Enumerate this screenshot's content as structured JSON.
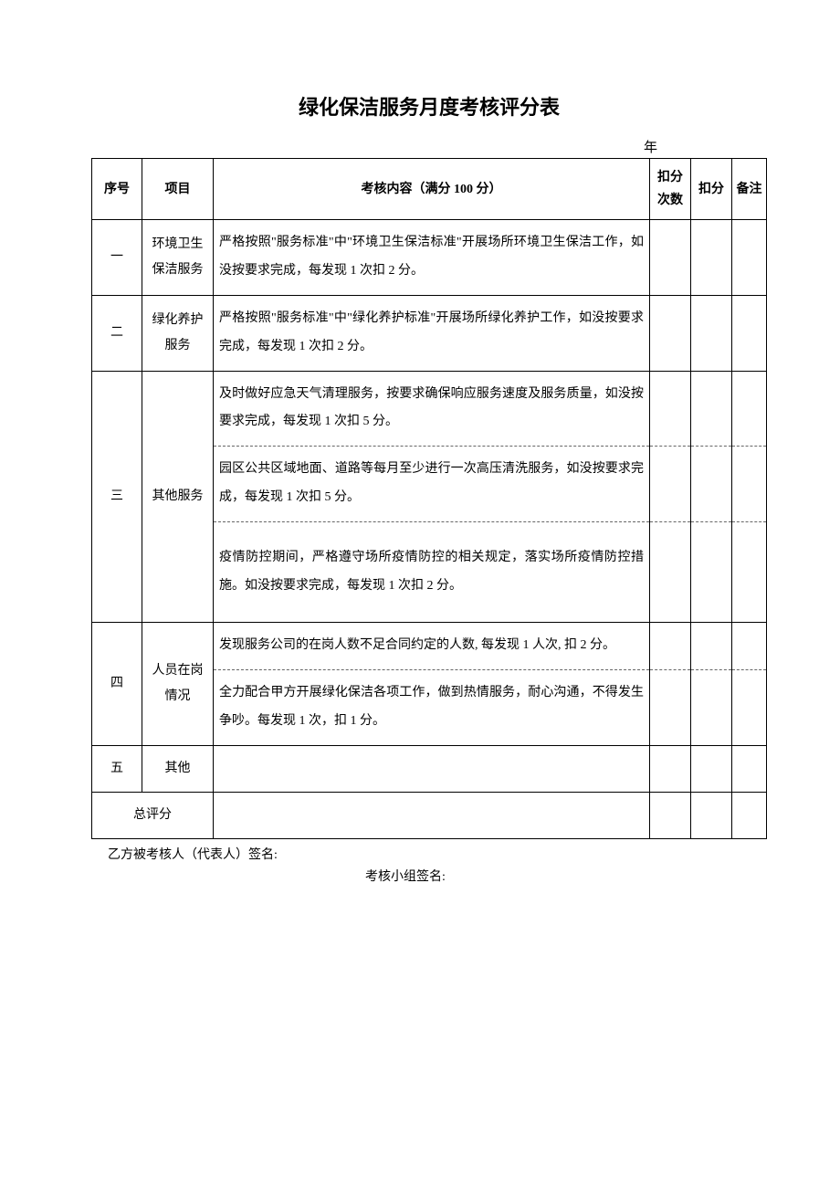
{
  "title": "绿化保洁服务月度考核评分表",
  "year_label": "年",
  "headers": {
    "seq": "序号",
    "item": "项目",
    "content": "考核内容（满分 100 分）",
    "count": "扣分次数",
    "score": "扣分",
    "note": "备注"
  },
  "rows": {
    "r1": {
      "seq": "一",
      "item": "环境卫生保洁服务",
      "content": "严格按照\"服务标准\"中\"环境卫生保洁标准\"开展场所环境卫生保洁工作，如没按要求完成，每发现 1 次扣 2 分。"
    },
    "r2": {
      "seq": "二",
      "item": "绿化养护服务",
      "content": "严格按照\"服务标准\"中\"绿化养护标准\"开展场所绿化养护工作，如没按要求完成，每发现 1 次扣 2 分。"
    },
    "r3": {
      "seq": "三",
      "item": "其他服务",
      "c1": "及时做好应急天气清理服务，按要求确保响应服务速度及服务质量，如没按要求完成，每发现 1 次扣 5 分。",
      "c2": "园区公共区域地面、道路等每月至少进行一次高压清洗服务，如没按要求完成，每发现 1 次扣 5 分。",
      "c3": "疫情防控期间，严格遵守场所疫情防控的相关规定，落实场所疫情防控措施。如没按要求完成，每发现 1 次扣 2 分。"
    },
    "r4": {
      "seq": "四",
      "item": "人员在岗情况",
      "c1": "发现服务公司的在岗人数不足合同约定的人数, 每发现 1 人次, 扣 2 分。",
      "c2": "全力配合甲方开展绿化保洁各项工作，做到热情服务，耐心沟通，不得发生争吵。每发现 1 次，扣 1 分。"
    },
    "r5": {
      "seq": "五",
      "item": "其他"
    },
    "total": "总评分"
  },
  "signatures": {
    "assessed": "乙方被考核人（代表人）签名:",
    "group": "考核小组签名:"
  }
}
